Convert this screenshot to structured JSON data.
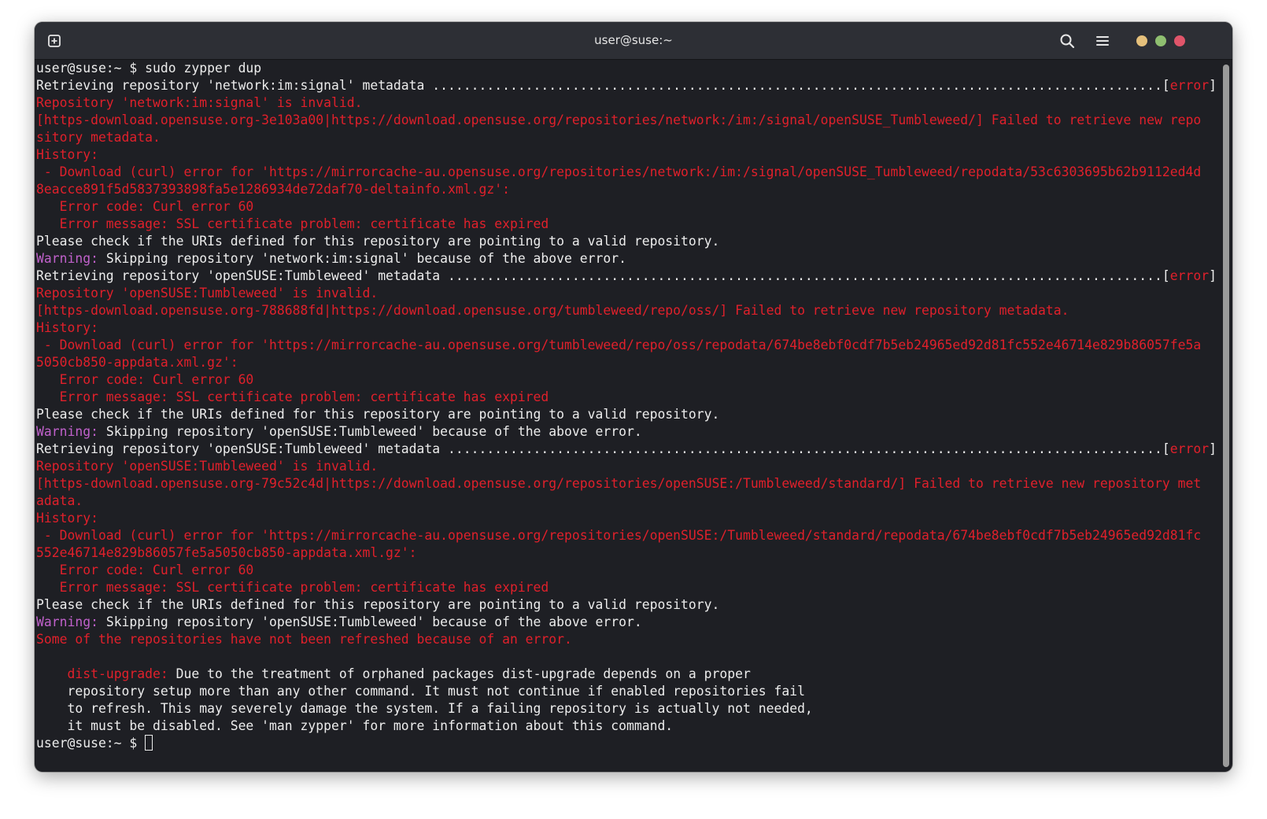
{
  "window": {
    "title": "user@suse:~"
  },
  "icons": {
    "new_tab": "new-tab-icon",
    "search": "search-icon",
    "menu": "hamburger-menu-icon"
  },
  "colors": {
    "minimize": "#e5c07b",
    "maximize": "#8fbf70",
    "close": "#e0556a",
    "error_red": "#e0202b",
    "warning_magenta": "#c061cb",
    "terminal_bg": "#1e1f24"
  },
  "terminal": {
    "lines": [
      [
        {
          "t": "user@suse:~ $ sudo zypper dup",
          "c": "w"
        }
      ],
      [
        {
          "t": "Retrieving repository 'network:im:signal' metadata ..............................................................................................[",
          "c": "w"
        },
        {
          "t": "error",
          "c": "r"
        },
        {
          "t": "]",
          "c": "w"
        }
      ],
      [
        {
          "t": "Repository 'network:im:signal' is invalid.",
          "c": "r"
        }
      ],
      [
        {
          "t": "[https-download.opensuse.org-3e103a00|https://download.opensuse.org/repositories/network:/im:/signal/openSUSE_Tumbleweed/] Failed to retrieve new repo",
          "c": "r"
        }
      ],
      [
        {
          "t": "sitory metadata.",
          "c": "r"
        }
      ],
      [
        {
          "t": "History:",
          "c": "r"
        }
      ],
      [
        {
          "t": " - Download (curl) error for 'https://mirrorcache-au.opensuse.org/repositories/network:/im:/signal/openSUSE_Tumbleweed/repodata/53c6303695b62b9112ed4d",
          "c": "r"
        }
      ],
      [
        {
          "t": "8eacce891f5d5837393898fa5e1286934de72daf70-deltainfo.xml.gz':",
          "c": "r"
        }
      ],
      [
        {
          "t": "   Error code: Curl error 60",
          "c": "r"
        }
      ],
      [
        {
          "t": "   Error message: SSL certificate problem: certificate has expired",
          "c": "r"
        }
      ],
      [
        {
          "t": "Please check if the URIs defined for this repository are pointing to a valid repository.",
          "c": "w"
        }
      ],
      [
        {
          "t": "Warning:",
          "c": "m"
        },
        {
          "t": " Skipping repository 'network:im:signal' because of the above error.",
          "c": "w"
        }
      ],
      [
        {
          "t": "Retrieving repository 'openSUSE:Tumbleweed' metadata ............................................................................................[",
          "c": "w"
        },
        {
          "t": "error",
          "c": "r"
        },
        {
          "t": "]",
          "c": "w"
        }
      ],
      [
        {
          "t": "Repository 'openSUSE:Tumbleweed' is invalid.",
          "c": "r"
        }
      ],
      [
        {
          "t": "[https-download.opensuse.org-788688fd|https://download.opensuse.org/tumbleweed/repo/oss/] Failed to retrieve new repository metadata.",
          "c": "r"
        }
      ],
      [
        {
          "t": "History:",
          "c": "r"
        }
      ],
      [
        {
          "t": " - Download (curl) error for 'https://mirrorcache-au.opensuse.org/tumbleweed/repo/oss/repodata/674be8ebf0cdf7b5eb24965ed92d81fc552e46714e829b86057fe5a",
          "c": "r"
        }
      ],
      [
        {
          "t": "5050cb850-appdata.xml.gz':",
          "c": "r"
        }
      ],
      [
        {
          "t": "   Error code: Curl error 60",
          "c": "r"
        }
      ],
      [
        {
          "t": "   Error message: SSL certificate problem: certificate has expired",
          "c": "r"
        }
      ],
      [
        {
          "t": "Please check if the URIs defined for this repository are pointing to a valid repository.",
          "c": "w"
        }
      ],
      [
        {
          "t": "Warning:",
          "c": "m"
        },
        {
          "t": " Skipping repository 'openSUSE:Tumbleweed' because of the above error.",
          "c": "w"
        }
      ],
      [
        {
          "t": "Retrieving repository 'openSUSE:Tumbleweed' metadata ............................................................................................[",
          "c": "w"
        },
        {
          "t": "error",
          "c": "r"
        },
        {
          "t": "]",
          "c": "w"
        }
      ],
      [
        {
          "t": "Repository 'openSUSE:Tumbleweed' is invalid.",
          "c": "r"
        }
      ],
      [
        {
          "t": "[https-download.opensuse.org-79c52c4d|https://download.opensuse.org/repositories/openSUSE:/Tumbleweed/standard/] Failed to retrieve new repository met",
          "c": "r"
        }
      ],
      [
        {
          "t": "adata.",
          "c": "r"
        }
      ],
      [
        {
          "t": "History:",
          "c": "r"
        }
      ],
      [
        {
          "t": " - Download (curl) error for 'https://mirrorcache-au.opensuse.org/repositories/openSUSE:/Tumbleweed/standard/repodata/674be8ebf0cdf7b5eb24965ed92d81fc",
          "c": "r"
        }
      ],
      [
        {
          "t": "552e46714e829b86057fe5a5050cb850-appdata.xml.gz':",
          "c": "r"
        }
      ],
      [
        {
          "t": "   Error code: Curl error 60",
          "c": "r"
        }
      ],
      [
        {
          "t": "   Error message: SSL certificate problem: certificate has expired",
          "c": "r"
        }
      ],
      [
        {
          "t": "Please check if the URIs defined for this repository are pointing to a valid repository.",
          "c": "w"
        }
      ],
      [
        {
          "t": "Warning:",
          "c": "m"
        },
        {
          "t": " Skipping repository 'openSUSE:Tumbleweed' because of the above error.",
          "c": "w"
        }
      ],
      [
        {
          "t": "Some of the repositories have not been refreshed because of an error.",
          "c": "r"
        }
      ],
      [
        {
          "t": "",
          "c": "w"
        }
      ],
      [
        {
          "t": "    ",
          "c": "w"
        },
        {
          "t": "dist-upgrade:",
          "c": "r"
        },
        {
          "t": " Due to the treatment of orphaned packages dist-upgrade depends on a proper",
          "c": "w"
        }
      ],
      [
        {
          "t": "    repository setup more than any other command. It must not continue if enabled repositories fail",
          "c": "w"
        }
      ],
      [
        {
          "t": "    to refresh. This may severely damage the system. If a failing repository is actually not needed,",
          "c": "w"
        }
      ],
      [
        {
          "t": "    it must be disabled. See 'man zypper' for more information about this command.",
          "c": "w"
        }
      ]
    ],
    "prompt": "user@suse:~ $ "
  }
}
